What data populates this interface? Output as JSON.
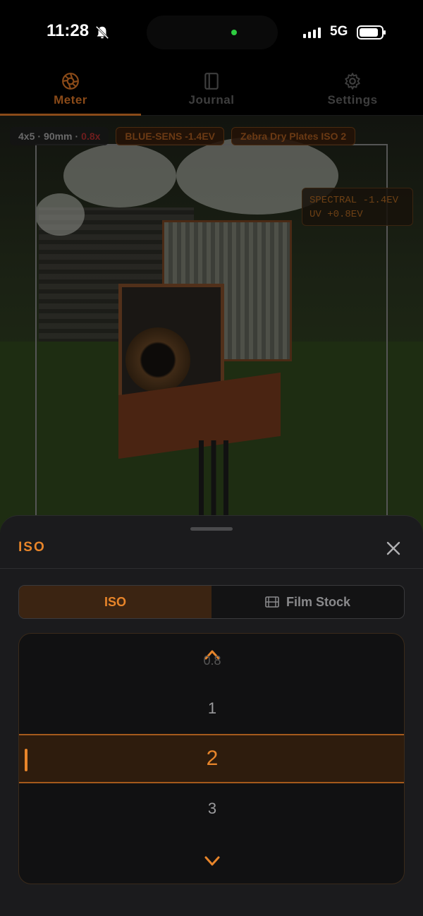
{
  "status_bar": {
    "time": "11:28",
    "network": "5G",
    "battery_level": 0.85,
    "signal_bars": 4
  },
  "nav": {
    "tabs": [
      {
        "label": "Meter",
        "icon": "aperture-icon",
        "active": true
      },
      {
        "label": "Journal",
        "icon": "book-icon",
        "active": false
      },
      {
        "label": "Settings",
        "icon": "gear-icon",
        "active": false
      }
    ]
  },
  "viewfinder": {
    "format": "4x5",
    "lens": "90mm",
    "crop": "0.8x",
    "separator": "·",
    "sensitivity_badge": "BLUE-SENS -1.4EV",
    "film_badge": "Zebra Dry Plates ISO 2",
    "spectral_line1": "SPECTRAL -1.4EV",
    "spectral_line2": "UV +0.8EV"
  },
  "sheet": {
    "title": "ISO",
    "segments": {
      "iso_label": "ISO",
      "film_stock_label": "Film Stock"
    },
    "picker": {
      "above_faded": "0.8",
      "above": "1",
      "selected": "2",
      "below": "3"
    }
  },
  "colors": {
    "accent": "#e8852a",
    "accent_dim": "#8a4a18",
    "sheet_bg": "#1b1b1d"
  }
}
